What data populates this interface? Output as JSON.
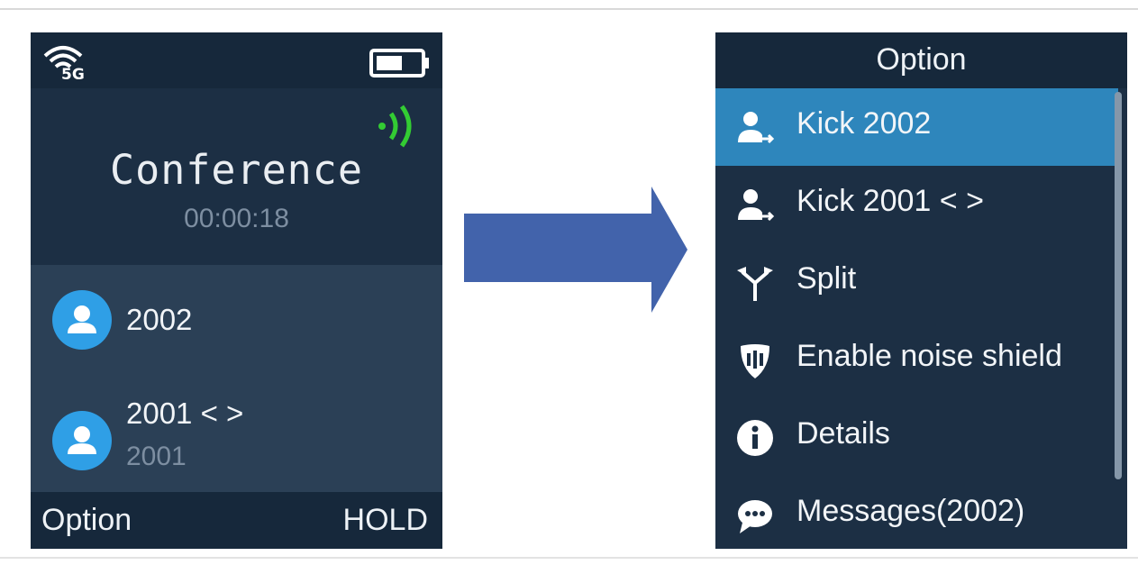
{
  "left_screen": {
    "status": {
      "wifi_icon": "wifi-5g-icon",
      "wifi_badge": "5G",
      "battery_icon": "battery-icon",
      "call_indicator_icon": "sound-waves-icon"
    },
    "call_title": "Conference",
    "call_timer": "00:00:18",
    "participants": [
      {
        "name": "2002",
        "sub": ""
      },
      {
        "name": "2001 < >",
        "sub": "2001"
      }
    ],
    "softkeys": {
      "left": "Option",
      "right": "HOLD"
    }
  },
  "arrow_icon": "right-arrow-icon",
  "right_screen": {
    "header": "Option",
    "items": [
      {
        "label": "Kick 2002",
        "icon": "kick-user-icon",
        "selected": true
      },
      {
        "label": "Kick 2001 < >",
        "icon": "kick-user-icon",
        "selected": false
      },
      {
        "label": "Split",
        "icon": "split-icon",
        "selected": false
      },
      {
        "label": "Enable noise shield",
        "icon": "noise-shield-icon",
        "selected": false
      },
      {
        "label": "Details",
        "icon": "info-icon",
        "selected": false
      },
      {
        "label": "Messages(2002)",
        "icon": "message-icon",
        "selected": false
      }
    ]
  },
  "colors": {
    "screen_bg": "#1c2f44",
    "bar_bg": "#16283b",
    "selected_bg": "#2e86bc",
    "avatar": "#2f9fe6",
    "signal_green": "#33cc33",
    "arrow": "#4263ab"
  }
}
